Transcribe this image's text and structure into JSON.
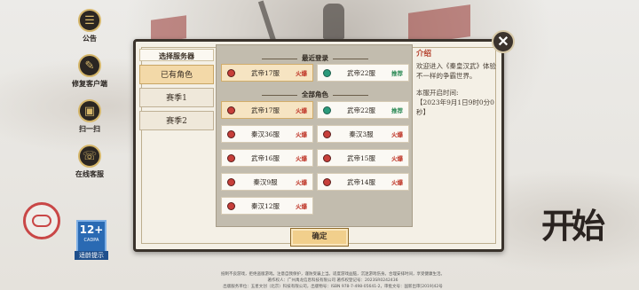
{
  "left_nav": [
    {
      "label": "公告",
      "icon": "notice-icon",
      "glyph": "☰"
    },
    {
      "label": "修复客户端",
      "icon": "wrench-icon",
      "glyph": "✎"
    },
    {
      "label": "扫一扫",
      "icon": "scan-icon",
      "glyph": "▣"
    },
    {
      "label": "在线客服",
      "icon": "service-icon",
      "glyph": "☏"
    }
  ],
  "age_rating": {
    "number": "12+",
    "org": "CADPA",
    "label": "适龄提示"
  },
  "start_label": "开始",
  "dialog": {
    "tabs_header": "选择服务器",
    "tabs": [
      "已有角色",
      "赛季1",
      "赛季2"
    ],
    "recent_title": "最近登录",
    "all_title": "全部角色",
    "recent_servers": [
      {
        "name": "武帝17服",
        "tag": "火爆",
        "status": "red",
        "tag_type": "hot"
      },
      {
        "name": "武帝22服",
        "tag": "推荐",
        "status": "green",
        "tag_type": "rec"
      }
    ],
    "all_servers": [
      {
        "name": "武帝17服",
        "tag": "火爆",
        "status": "red",
        "tag_type": "hot"
      },
      {
        "name": "武帝22服",
        "tag": "推荐",
        "status": "green",
        "tag_type": "rec"
      },
      {
        "name": "秦汉36服",
        "tag": "火爆",
        "status": "red",
        "tag_type": "hot"
      },
      {
        "name": "秦汉3服",
        "tag": "火爆",
        "status": "red",
        "tag_type": "hot"
      },
      {
        "name": "武帝16服",
        "tag": "火爆",
        "status": "red",
        "tag_type": "hot"
      },
      {
        "name": "武帝15服",
        "tag": "火爆",
        "status": "red",
        "tag_type": "hot"
      },
      {
        "name": "秦汉9服",
        "tag": "火爆",
        "status": "red",
        "tag_type": "hot"
      },
      {
        "name": "武帝14服",
        "tag": "火爆",
        "status": "red",
        "tag_type": "hot"
      },
      {
        "name": "秦汉12服",
        "tag": "火爆",
        "status": "red",
        "tag_type": "hot"
      }
    ],
    "info_title": "介绍",
    "info_intro": "欢迎进入《秦皇汉武》体验不一样的争霸世界。",
    "info_open_label": "本服开启时间:",
    "info_open_time": "【2023年9月1日9时0分0秒】",
    "confirm_label": "确定",
    "close_glyph": "✕"
  },
  "footer": {
    "line1": "抵制不良游戏，拒绝盗版游戏。注意自我保护，谨防受骗上当。适度游戏益脑，沉迷游戏伤身。合理安排时间，享受健康生活。",
    "line2": "著作权人：广州禹龙信息科技有限公司 著作权登记号：2023SR0242436",
    "line3": "出版服务单位：五星文创（北京）科技有限公司，出版物号：ISBN 978-7-498-05641-2，审批文号：国新出审[2019]42号"
  },
  "colors": {
    "accent": "#f1cf8c",
    "hot": "#c0392b",
    "recommend": "#2e8b57",
    "panel_border": "#3a332c"
  }
}
